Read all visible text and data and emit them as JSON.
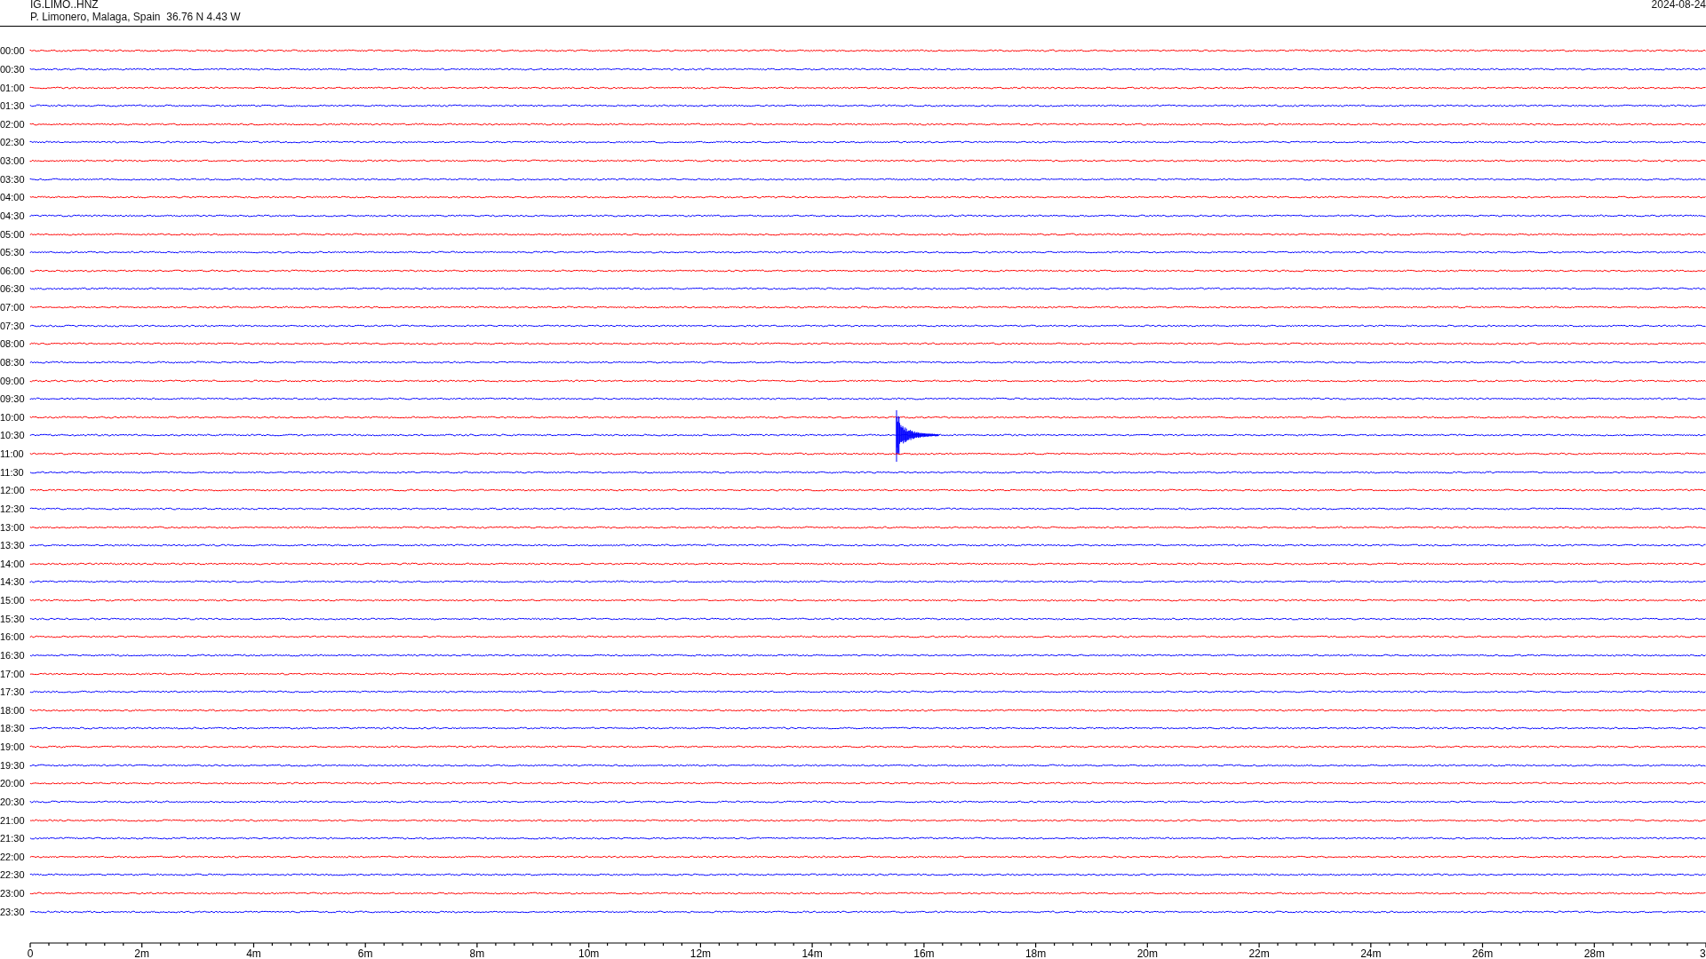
{
  "header": {
    "station": "IG.LIMO..HNZ",
    "location": "P. Limonero, Malaga, Spain  36.76 N 4.43 W",
    "date": "2024-08-24"
  },
  "rows": [
    {
      "label": "00:00",
      "color": "#ff0000",
      "event": false
    },
    {
      "label": "00:30",
      "color": "#0000ff",
      "event": false
    },
    {
      "label": "01:00",
      "color": "#ff0000",
      "event": false
    },
    {
      "label": "01:30",
      "color": "#0000ff",
      "event": false
    },
    {
      "label": "02:00",
      "color": "#ff0000",
      "event": false
    },
    {
      "label": "02:30",
      "color": "#0000ff",
      "event": false
    },
    {
      "label": "03:00",
      "color": "#ff0000",
      "event": false
    },
    {
      "label": "03:30",
      "color": "#0000ff",
      "event": false
    },
    {
      "label": "04:00",
      "color": "#ff0000",
      "event": false
    },
    {
      "label": "04:30",
      "color": "#0000ff",
      "event": false
    },
    {
      "label": "05:00",
      "color": "#ff0000",
      "event": false
    },
    {
      "label": "05:30",
      "color": "#0000ff",
      "event": false
    },
    {
      "label": "06:00",
      "color": "#ff0000",
      "event": false
    },
    {
      "label": "06:30",
      "color": "#0000ff",
      "event": false
    },
    {
      "label": "07:00",
      "color": "#ff0000",
      "event": false
    },
    {
      "label": "07:30",
      "color": "#0000ff",
      "event": false
    },
    {
      "label": "08:00",
      "color": "#ff0000",
      "event": false
    },
    {
      "label": "08:30",
      "color": "#0000ff",
      "event": false
    },
    {
      "label": "09:00",
      "color": "#ff0000",
      "event": false
    },
    {
      "label": "09:30",
      "color": "#0000ff",
      "event": false
    },
    {
      "label": "10:00",
      "color": "#ff0000",
      "event": false
    },
    {
      "label": "10:30",
      "color": "#0000ff",
      "event": true
    },
    {
      "label": "11:00",
      "color": "#ff0000",
      "event": false
    },
    {
      "label": "11:30",
      "color": "#0000ff",
      "event": false
    },
    {
      "label": "12:00",
      "color": "#ff0000",
      "event": false
    },
    {
      "label": "12:30",
      "color": "#0000ff",
      "event": false
    },
    {
      "label": "13:00",
      "color": "#ff0000",
      "event": false
    },
    {
      "label": "13:30",
      "color": "#0000ff",
      "event": false
    },
    {
      "label": "14:00",
      "color": "#ff0000",
      "event": false
    },
    {
      "label": "14:30",
      "color": "#0000ff",
      "event": false
    },
    {
      "label": "15:00",
      "color": "#ff0000",
      "event": false
    },
    {
      "label": "15:30",
      "color": "#0000ff",
      "event": false
    },
    {
      "label": "16:00",
      "color": "#ff0000",
      "event": false
    },
    {
      "label": "16:30",
      "color": "#0000ff",
      "event": false
    },
    {
      "label": "17:00",
      "color": "#ff0000",
      "event": false
    },
    {
      "label": "17:30",
      "color": "#0000ff",
      "event": false
    },
    {
      "label": "18:00",
      "color": "#ff0000",
      "event": false
    },
    {
      "label": "18:30",
      "color": "#0000ff",
      "event": false
    },
    {
      "label": "19:00",
      "color": "#ff0000",
      "event": false
    },
    {
      "label": "19:30",
      "color": "#0000ff",
      "event": false
    },
    {
      "label": "20:00",
      "color": "#ff0000",
      "event": false
    },
    {
      "label": "20:30",
      "color": "#0000ff",
      "event": false
    },
    {
      "label": "21:00",
      "color": "#ff0000",
      "event": false
    },
    {
      "label": "21:30",
      "color": "#0000ff",
      "event": false
    },
    {
      "label": "22:00",
      "color": "#ff0000",
      "event": false
    },
    {
      "label": "22:30",
      "color": "#0000ff",
      "event": false
    },
    {
      "label": "23:00",
      "color": "#ff0000",
      "event": false
    },
    {
      "label": "23:30",
      "color": "#0000ff",
      "event": false
    }
  ],
  "axis": {
    "labels": [
      "0",
      "2m",
      "4m",
      "6m",
      "8m",
      "10m",
      "12m",
      "14m",
      "16m",
      "18m",
      "20m",
      "22m",
      "24m",
      "26m",
      "28m",
      "3"
    ]
  }
}
